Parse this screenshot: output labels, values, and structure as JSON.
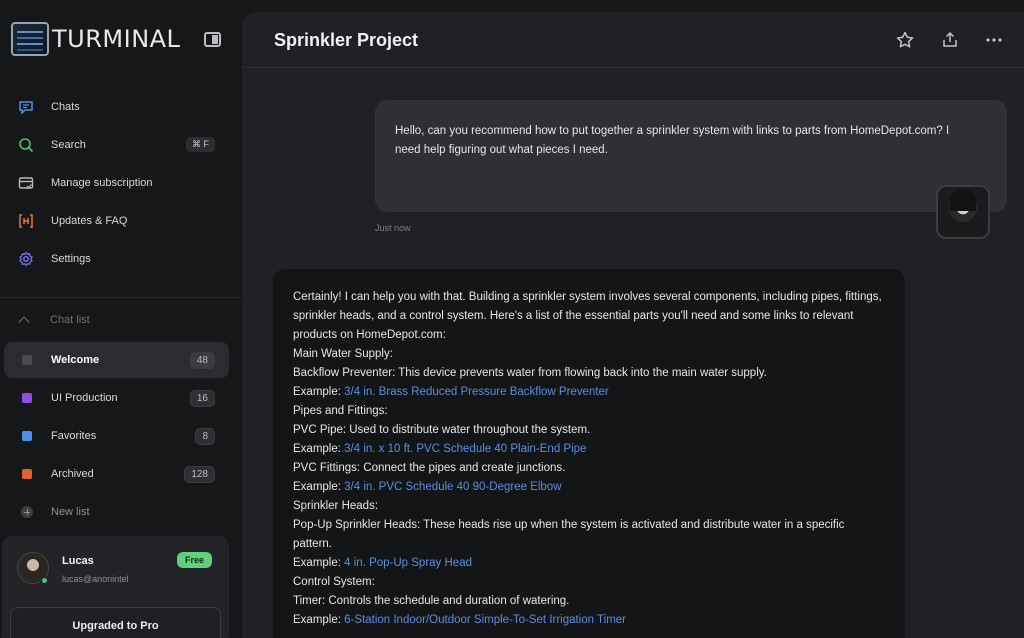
{
  "app": {
    "name": "TURMINAL"
  },
  "nav": [
    {
      "label": "Chats",
      "icon": "chat-bubble-icon",
      "color": "#4d8fe8"
    },
    {
      "label": "Search",
      "icon": "search-icon",
      "color": "#4cc16a",
      "shortcut": "⌘ F"
    },
    {
      "label": "Manage subscription",
      "icon": "card-icon",
      "color": "#b9bcc0"
    },
    {
      "label": "Updates & FAQ",
      "icon": "updates-icon",
      "color": "#e2793b"
    },
    {
      "label": "Settings",
      "icon": "gear-icon",
      "color": "#7a6cf0"
    }
  ],
  "chat_list": {
    "heading": "Chat list",
    "items": [
      {
        "label": "Welcome",
        "count": "48",
        "color": "#4a4c50",
        "active": true
      },
      {
        "label": "UI Production",
        "count": "16",
        "color": "#8e4fe0"
      },
      {
        "label": "Favorites",
        "count": "8",
        "color": "#4d8fe8"
      },
      {
        "label": "Archived",
        "count": "128",
        "color": "#e0612f"
      }
    ],
    "new_list": "New list"
  },
  "user": {
    "name": "Lucas",
    "email": "lucas@anonintel",
    "plan_badge": "Free",
    "upgrade_label": "Upgraded to Pro"
  },
  "conversation": {
    "title": "Sprinkler Project",
    "user_message": "Hello, can you recommend how to put together a sprinkler system with links to parts from HomeDepot.com? I need help figuring out what pieces I need.",
    "timestamp": "Just now",
    "reply": {
      "intro": "Certainly! I can help you with that. Building a sprinkler system involves several components, including pipes, fittings, sprinkler heads, and a control system. Here's a list of the essential parts you'll need and some links to relevant products on HomeDepot.com:",
      "s1_heading": "Main Water Supply:",
      "s1_desc": "Backflow Preventer: This device prevents water from flowing back into the main water supply.",
      "s1_prefix": "Example: ",
      "s1_link": "3/4 in. Brass Reduced Pressure Backflow Preventer",
      "s2_heading": "Pipes and Fittings:",
      "s2_desc1": "PVC Pipe: Used to distribute water throughout the system.",
      "s2_prefix1": "Example: ",
      "s2_link1": "3/4 in. x 10 ft. PVC Schedule 40 Plain-End Pipe",
      "s2_desc2": "PVC Fittings: Connect the pipes and create junctions.",
      "s2_prefix2": "Example: ",
      "s2_link2": "3/4 in. PVC Schedule 40 90-Degree Elbow",
      "s3_heading": "Sprinkler Heads:",
      "s3_desc": "Pop-Up Sprinkler Heads: These heads rise up when the system is activated and distribute water in a specific pattern.",
      "s3_prefix": "Example: ",
      "s3_link": "4 in. Pop-Up Spray Head",
      "s4_heading": "Control System:",
      "s4_desc": "Timer: Controls the schedule and duration of watering.",
      "s4_prefix": "Example: ",
      "s4_link": "6-Station Indoor/Outdoor Simple-To-Set Irrigation Timer"
    }
  },
  "header_icons": [
    "star-icon",
    "share-icon",
    "more-icon"
  ]
}
